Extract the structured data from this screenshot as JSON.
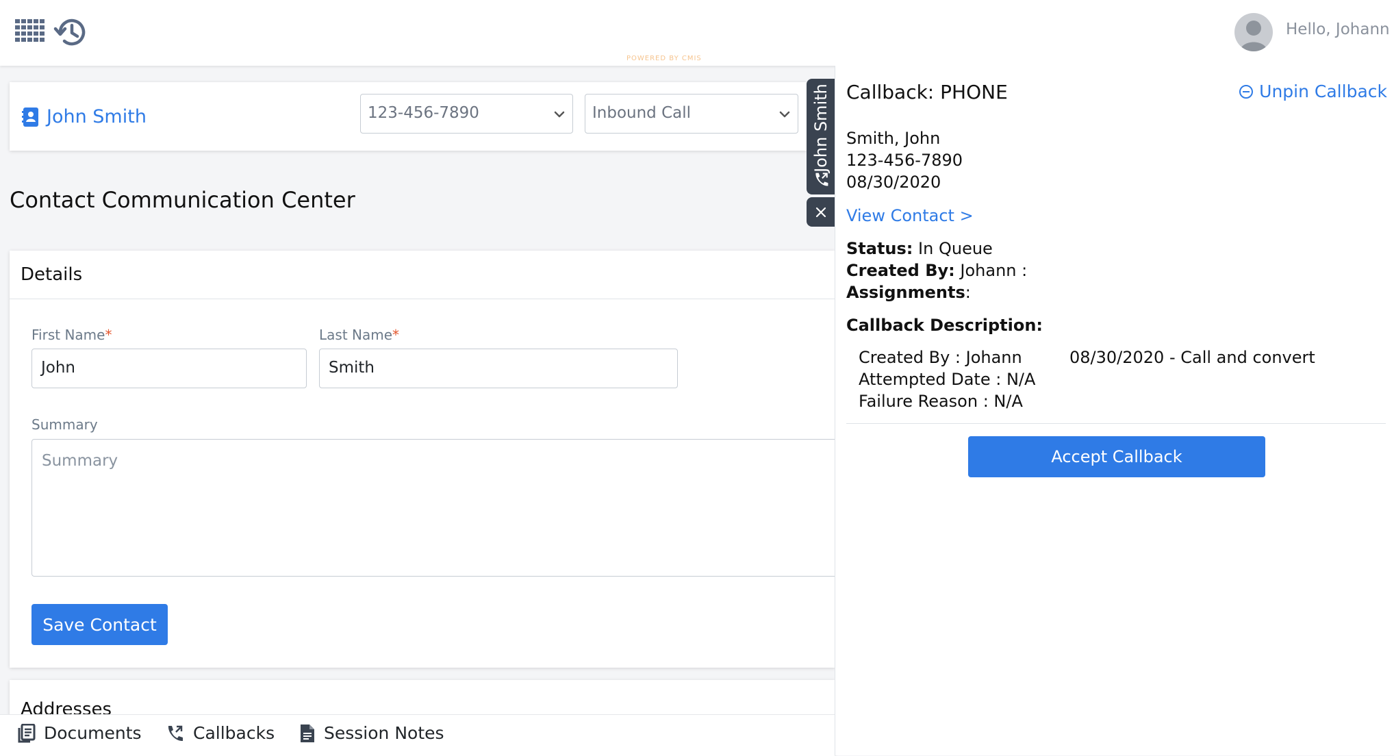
{
  "topbar": {
    "greeting": "Hello, Johann",
    "powered_by": "POWERED BY CMIS",
    "icons": [
      "apps-grid-icon",
      "history-icon",
      "avatar"
    ]
  },
  "contact": {
    "name": "John Smith",
    "phone_select": "123-456-7890",
    "call_type_select": "Inbound Call"
  },
  "page": {
    "title": "Contact Communication Center"
  },
  "details": {
    "title": "Details",
    "first_name_label": "First Name",
    "first_name_value": "John",
    "last_name_label": "Last Name",
    "last_name_value": "Smith",
    "required_mark": "*",
    "summary_label": "Summary",
    "summary_placeholder": "Summary",
    "save_label": "Save Contact"
  },
  "addresses": {
    "title": "Addresses"
  },
  "bottom_tabs": [
    {
      "label": "Documents",
      "icon": "documents-icon"
    },
    {
      "label": "Callbacks",
      "icon": "callback-phone-icon"
    },
    {
      "label": "Session Notes",
      "icon": "note-icon"
    }
  ],
  "session_tab": {
    "label": "John Smith",
    "icon": "callback-phone-icon",
    "close_icon": "close-icon"
  },
  "callback": {
    "title": "Callback: PHONE",
    "unpin_label": "Unpin Callback",
    "contact_name": "Smith, John",
    "phone": "123-456-7890",
    "date": "08/30/2020",
    "view_contact": "View Contact >",
    "status_label": "Status:",
    "status_value": "In Queue",
    "created_by_label": "Created By:",
    "created_by_value": "Johann :",
    "assignments_label": "Assignments",
    "assignments_colon": ":",
    "description_label": "Callback Description:",
    "desc_created_by": "Created By : Johann",
    "desc_attempted": "Attempted Date : N/A",
    "desc_failure": "Failure Reason : N/A",
    "desc_note": "08/30/2020 - Call and convert",
    "accept_label": "Accept Callback"
  },
  "colors": {
    "accent": "#2f7be6",
    "required": "#e4572e",
    "dark_tab": "#3a4350",
    "background": "#f4f5f7"
  }
}
